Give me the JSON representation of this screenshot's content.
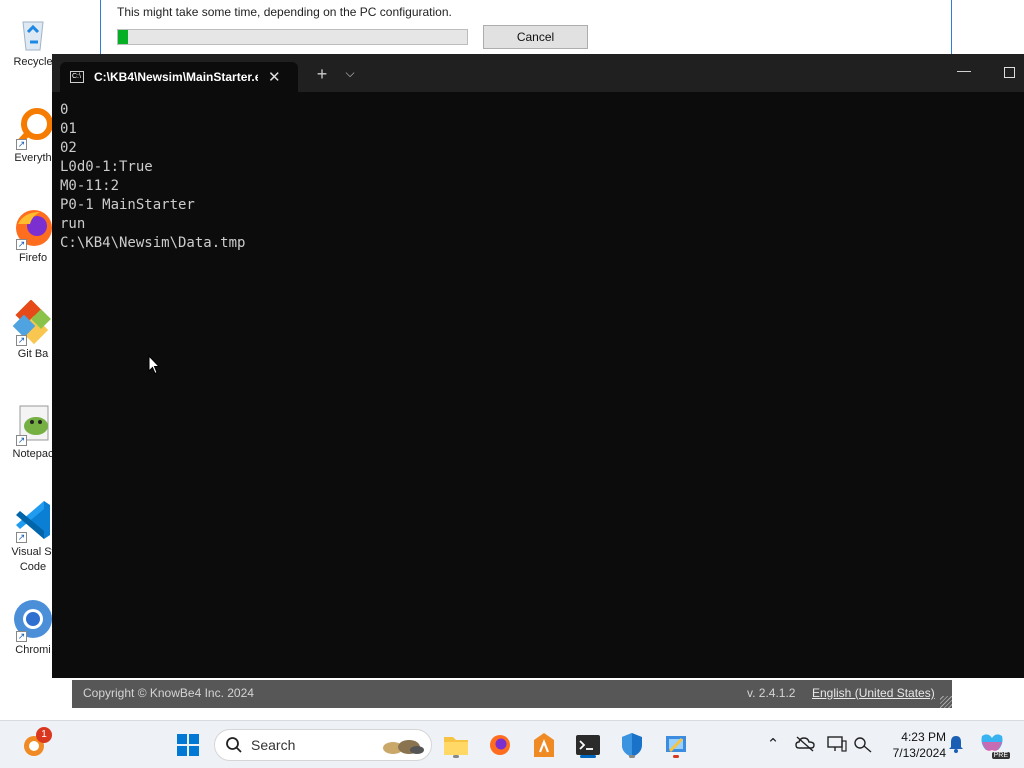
{
  "desktop": {
    "icons": [
      {
        "label": "Recycle",
        "icon": "recycle-bin-icon"
      },
      {
        "label": "Everyth",
        "icon": "everything-search-icon"
      },
      {
        "label": "Firefo",
        "icon": "firefox-icon"
      },
      {
        "label": "Git Ba",
        "icon": "git-bash-icon"
      },
      {
        "label": "Notepac",
        "icon": "notepad-plus-icon"
      },
      {
        "label": "Visual St Code",
        "icon": "vscode-icon"
      },
      {
        "label": "Chromi",
        "icon": "chromium-icon"
      }
    ]
  },
  "installer": {
    "message": "This might take some time, depending on the PC configuration.",
    "progress_fraction": 0.03,
    "cancel_label": "Cancel",
    "footer": {
      "copyright": "Copyright © KnowBe4 Inc. 2024",
      "version": "v. 2.4.1.2",
      "language": "English (United States)"
    }
  },
  "terminal": {
    "tab_title": "C:\\KB4\\Newsim\\MainStarter.e",
    "new_tab_glyph": "+",
    "dropdown_glyph": "⌵",
    "minimize_glyph": "—",
    "close_glyph": "✕",
    "output": "0\n01\n02\nL0d0-1:True\nM0-11:2\nP0-1 MainStarter\nrun\nC:\\KB4\\Newsim\\Data.tmp"
  },
  "taskbar": {
    "search_placeholder": "Search",
    "notification_badge": "1",
    "time": "4:23 PM",
    "date": "7/13/2024",
    "copilot_badge": "PRE"
  },
  "colors": {
    "terminal_bg": "#0c0c0c",
    "terminal_text": "#cccccc",
    "progress_fill": "#06b025",
    "footer_bg": "#575757",
    "accent": "#0067c0"
  }
}
